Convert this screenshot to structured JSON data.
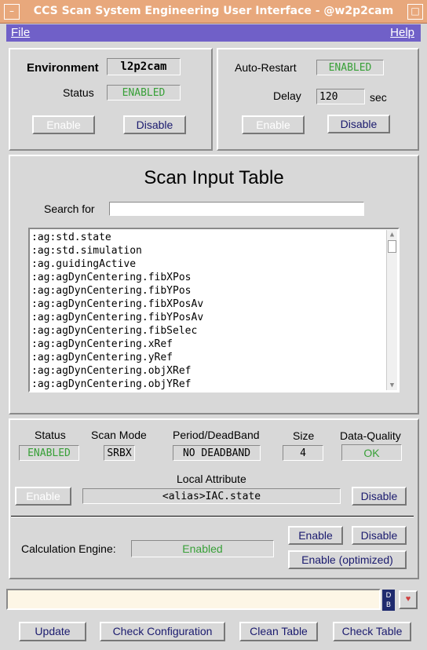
{
  "window": {
    "title": "CCS Scan System Engineering User Interface - @w2p2cam"
  },
  "menu": {
    "file": "File",
    "help": "Help"
  },
  "env_panel": {
    "environment_label": "Environment",
    "environment_value": "l2p2cam",
    "status_label": "Status",
    "status_value": "ENABLED",
    "enable_label": "Enable",
    "disable_label": "Disable"
  },
  "restart_panel": {
    "auto_restart_label": "Auto-Restart",
    "auto_restart_value": "ENABLED",
    "delay_label": "Delay",
    "delay_value": "120",
    "delay_unit": "sec",
    "enable_label": "Enable",
    "disable_label": "Disable"
  },
  "scan_table": {
    "title": "Scan Input Table",
    "search_label": "Search for",
    "search_value": "",
    "items": [
      ":ag:std.state",
      ":ag:std.simulation",
      ":ag.guidingActive",
      ":ag:agDynCentering.fibXPos",
      ":ag:agDynCentering.fibYPos",
      ":ag:agDynCentering.fibXPosAv",
      ":ag:agDynCentering.fibYPosAv",
      ":ag:agDynCentering.fibSelec",
      ":ag:agDynCentering.xRef",
      ":ag:agDynCentering.yRef",
      ":ag:agDynCentering.objXRef",
      ":ag:agDynCentering.objYRef"
    ]
  },
  "attr_panel": {
    "status_label": "Status",
    "status_value": "ENABLED",
    "scan_mode_label": "Scan Mode",
    "scan_mode_value": "SRBX",
    "period_label": "Period/DeadBand",
    "period_value": "NO DEADBAND",
    "size_label": "Size",
    "size_value": "4",
    "quality_label": "Data-Quality",
    "quality_value": "OK",
    "local_attr_label": "Local Attribute",
    "local_attr_value": "<alias>IAC.state",
    "enable_label": "Enable",
    "disable_label": "Disable",
    "calc_label": "Calculation Engine:",
    "calc_value": "Enabled",
    "calc_enable_label": "Enable",
    "calc_disable_label": "Disable",
    "calc_optimized_label": "Enable (optimized)"
  },
  "command": {
    "value": "",
    "db_badge": "DB"
  },
  "bottom": {
    "update": "Update",
    "check_config": "Check Configuration",
    "clean_table": "Clean Table",
    "check_table": "Check Table"
  }
}
